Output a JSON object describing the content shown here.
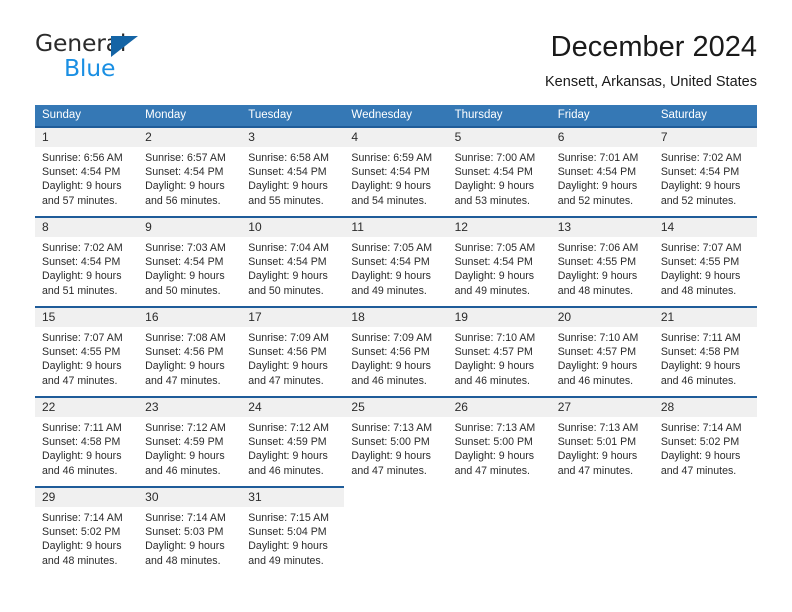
{
  "brand": {
    "name_top": "General",
    "name_bottom": "Blue",
    "color_dark": "#2b2b2b",
    "color_blue": "#1a8fe3",
    "triangle_color": "#1464a5"
  },
  "header": {
    "title": "December 2024",
    "subtitle": "Kensett, Arkansas, United States"
  },
  "theme": {
    "header_bg": "#3578b5",
    "header_text": "#ffffff",
    "row_divider": "#1f5c99",
    "daynum_bg": "#f0f0f0",
    "body_text": "#2b2b2b"
  },
  "weekdays": [
    "Sunday",
    "Monday",
    "Tuesday",
    "Wednesday",
    "Thursday",
    "Friday",
    "Saturday"
  ],
  "weeks": [
    [
      {
        "day": "1",
        "sunrise": "Sunrise: 6:56 AM",
        "sunset": "Sunset: 4:54 PM",
        "daylight1": "Daylight: 9 hours",
        "daylight2": "and 57 minutes."
      },
      {
        "day": "2",
        "sunrise": "Sunrise: 6:57 AM",
        "sunset": "Sunset: 4:54 PM",
        "daylight1": "Daylight: 9 hours",
        "daylight2": "and 56 minutes."
      },
      {
        "day": "3",
        "sunrise": "Sunrise: 6:58 AM",
        "sunset": "Sunset: 4:54 PM",
        "daylight1": "Daylight: 9 hours",
        "daylight2": "and 55 minutes."
      },
      {
        "day": "4",
        "sunrise": "Sunrise: 6:59 AM",
        "sunset": "Sunset: 4:54 PM",
        "daylight1": "Daylight: 9 hours",
        "daylight2": "and 54 minutes."
      },
      {
        "day": "5",
        "sunrise": "Sunrise: 7:00 AM",
        "sunset": "Sunset: 4:54 PM",
        "daylight1": "Daylight: 9 hours",
        "daylight2": "and 53 minutes."
      },
      {
        "day": "6",
        "sunrise": "Sunrise: 7:01 AM",
        "sunset": "Sunset: 4:54 PM",
        "daylight1": "Daylight: 9 hours",
        "daylight2": "and 52 minutes."
      },
      {
        "day": "7",
        "sunrise": "Sunrise: 7:02 AM",
        "sunset": "Sunset: 4:54 PM",
        "daylight1": "Daylight: 9 hours",
        "daylight2": "and 52 minutes."
      }
    ],
    [
      {
        "day": "8",
        "sunrise": "Sunrise: 7:02 AM",
        "sunset": "Sunset: 4:54 PM",
        "daylight1": "Daylight: 9 hours",
        "daylight2": "and 51 minutes."
      },
      {
        "day": "9",
        "sunrise": "Sunrise: 7:03 AM",
        "sunset": "Sunset: 4:54 PM",
        "daylight1": "Daylight: 9 hours",
        "daylight2": "and 50 minutes."
      },
      {
        "day": "10",
        "sunrise": "Sunrise: 7:04 AM",
        "sunset": "Sunset: 4:54 PM",
        "daylight1": "Daylight: 9 hours",
        "daylight2": "and 50 minutes."
      },
      {
        "day": "11",
        "sunrise": "Sunrise: 7:05 AM",
        "sunset": "Sunset: 4:54 PM",
        "daylight1": "Daylight: 9 hours",
        "daylight2": "and 49 minutes."
      },
      {
        "day": "12",
        "sunrise": "Sunrise: 7:05 AM",
        "sunset": "Sunset: 4:54 PM",
        "daylight1": "Daylight: 9 hours",
        "daylight2": "and 49 minutes."
      },
      {
        "day": "13",
        "sunrise": "Sunrise: 7:06 AM",
        "sunset": "Sunset: 4:55 PM",
        "daylight1": "Daylight: 9 hours",
        "daylight2": "and 48 minutes."
      },
      {
        "day": "14",
        "sunrise": "Sunrise: 7:07 AM",
        "sunset": "Sunset: 4:55 PM",
        "daylight1": "Daylight: 9 hours",
        "daylight2": "and 48 minutes."
      }
    ],
    [
      {
        "day": "15",
        "sunrise": "Sunrise: 7:07 AM",
        "sunset": "Sunset: 4:55 PM",
        "daylight1": "Daylight: 9 hours",
        "daylight2": "and 47 minutes."
      },
      {
        "day": "16",
        "sunrise": "Sunrise: 7:08 AM",
        "sunset": "Sunset: 4:56 PM",
        "daylight1": "Daylight: 9 hours",
        "daylight2": "and 47 minutes."
      },
      {
        "day": "17",
        "sunrise": "Sunrise: 7:09 AM",
        "sunset": "Sunset: 4:56 PM",
        "daylight1": "Daylight: 9 hours",
        "daylight2": "and 47 minutes."
      },
      {
        "day": "18",
        "sunrise": "Sunrise: 7:09 AM",
        "sunset": "Sunset: 4:56 PM",
        "daylight1": "Daylight: 9 hours",
        "daylight2": "and 46 minutes."
      },
      {
        "day": "19",
        "sunrise": "Sunrise: 7:10 AM",
        "sunset": "Sunset: 4:57 PM",
        "daylight1": "Daylight: 9 hours",
        "daylight2": "and 46 minutes."
      },
      {
        "day": "20",
        "sunrise": "Sunrise: 7:10 AM",
        "sunset": "Sunset: 4:57 PM",
        "daylight1": "Daylight: 9 hours",
        "daylight2": "and 46 minutes."
      },
      {
        "day": "21",
        "sunrise": "Sunrise: 7:11 AM",
        "sunset": "Sunset: 4:58 PM",
        "daylight1": "Daylight: 9 hours",
        "daylight2": "and 46 minutes."
      }
    ],
    [
      {
        "day": "22",
        "sunrise": "Sunrise: 7:11 AM",
        "sunset": "Sunset: 4:58 PM",
        "daylight1": "Daylight: 9 hours",
        "daylight2": "and 46 minutes."
      },
      {
        "day": "23",
        "sunrise": "Sunrise: 7:12 AM",
        "sunset": "Sunset: 4:59 PM",
        "daylight1": "Daylight: 9 hours",
        "daylight2": "and 46 minutes."
      },
      {
        "day": "24",
        "sunrise": "Sunrise: 7:12 AM",
        "sunset": "Sunset: 4:59 PM",
        "daylight1": "Daylight: 9 hours",
        "daylight2": "and 46 minutes."
      },
      {
        "day": "25",
        "sunrise": "Sunrise: 7:13 AM",
        "sunset": "Sunset: 5:00 PM",
        "daylight1": "Daylight: 9 hours",
        "daylight2": "and 47 minutes."
      },
      {
        "day": "26",
        "sunrise": "Sunrise: 7:13 AM",
        "sunset": "Sunset: 5:00 PM",
        "daylight1": "Daylight: 9 hours",
        "daylight2": "and 47 minutes."
      },
      {
        "day": "27",
        "sunrise": "Sunrise: 7:13 AM",
        "sunset": "Sunset: 5:01 PM",
        "daylight1": "Daylight: 9 hours",
        "daylight2": "and 47 minutes."
      },
      {
        "day": "28",
        "sunrise": "Sunrise: 7:14 AM",
        "sunset": "Sunset: 5:02 PM",
        "daylight1": "Daylight: 9 hours",
        "daylight2": "and 47 minutes."
      }
    ],
    [
      {
        "day": "29",
        "sunrise": "Sunrise: 7:14 AM",
        "sunset": "Sunset: 5:02 PM",
        "daylight1": "Daylight: 9 hours",
        "daylight2": "and 48 minutes."
      },
      {
        "day": "30",
        "sunrise": "Sunrise: 7:14 AM",
        "sunset": "Sunset: 5:03 PM",
        "daylight1": "Daylight: 9 hours",
        "daylight2": "and 48 minutes."
      },
      {
        "day": "31",
        "sunrise": "Sunrise: 7:15 AM",
        "sunset": "Sunset: 5:04 PM",
        "daylight1": "Daylight: 9 hours",
        "daylight2": "and 49 minutes."
      },
      {
        "day": "",
        "sunrise": "",
        "sunset": "",
        "daylight1": "",
        "daylight2": ""
      },
      {
        "day": "",
        "sunrise": "",
        "sunset": "",
        "daylight1": "",
        "daylight2": ""
      },
      {
        "day": "",
        "sunrise": "",
        "sunset": "",
        "daylight1": "",
        "daylight2": ""
      },
      {
        "day": "",
        "sunrise": "",
        "sunset": "",
        "daylight1": "",
        "daylight2": ""
      }
    ]
  ]
}
